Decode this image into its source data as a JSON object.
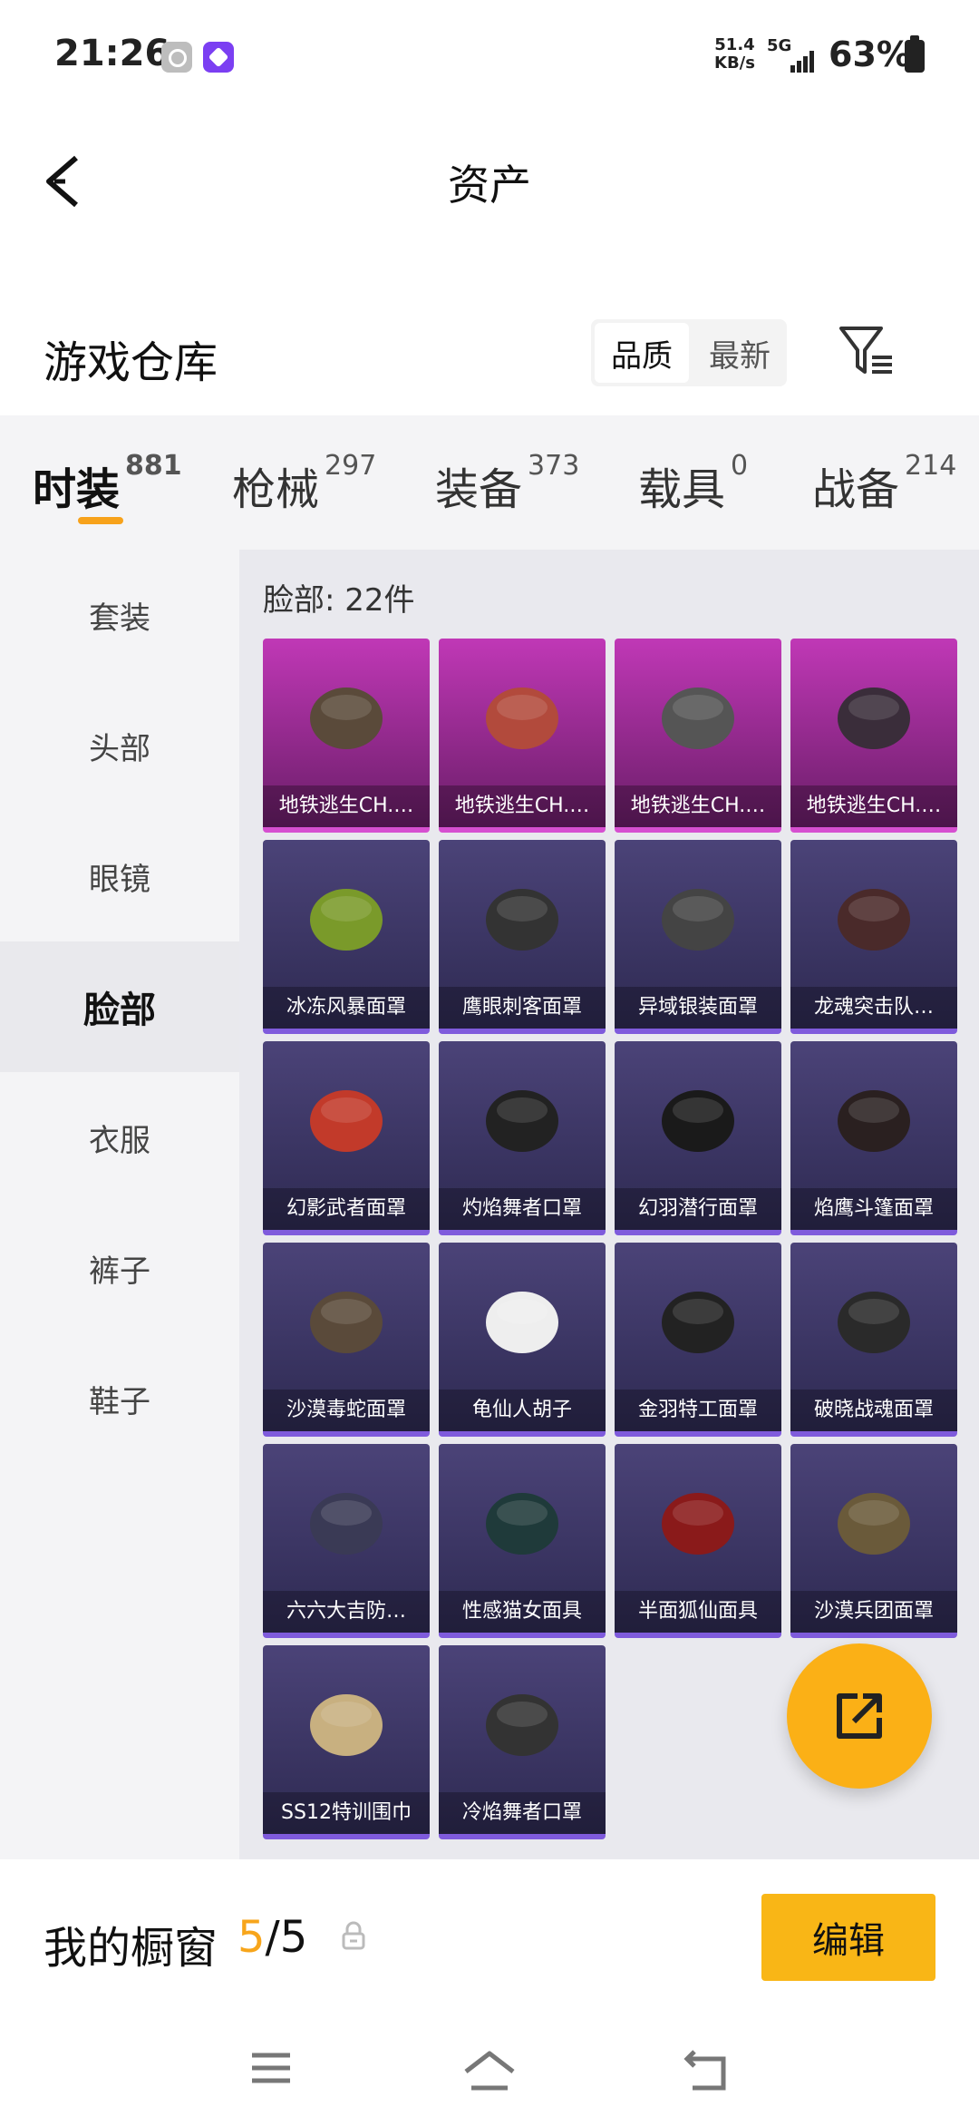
{
  "status_bar": {
    "time": "21:26",
    "speed_value": "51.4",
    "speed_unit": "KB/s",
    "network": "5G",
    "battery": "63%"
  },
  "header": {
    "title": "资产",
    "back_icon": "chevron-left-icon"
  },
  "warehouse": {
    "title": "游戏仓库",
    "sort_options": [
      "品质",
      "最新"
    ],
    "sort_selected": "品质",
    "filter_icon": "filter-icon"
  },
  "category_tabs": [
    {
      "label": "时装",
      "count": "881",
      "active": true
    },
    {
      "label": "枪械",
      "count": "297"
    },
    {
      "label": "装备",
      "count": "373"
    },
    {
      "label": "载具",
      "count": "0"
    },
    {
      "label": "战备",
      "count": "214"
    }
  ],
  "sidebar": {
    "items": [
      "套装",
      "头部",
      "眼镜",
      "脸部",
      "衣服",
      "裤子",
      "鞋子"
    ],
    "active": "脸部"
  },
  "content": {
    "label": "脸部: 22件",
    "items": [
      {
        "name": "地铁逃生CH.…",
        "rarity": "epic"
      },
      {
        "name": "地铁逃生CH.…",
        "rarity": "epic"
      },
      {
        "name": "地铁逃生CH.…",
        "rarity": "epic"
      },
      {
        "name": "地铁逃生CH.…",
        "rarity": "epic"
      },
      {
        "name": "冰冻风暴面罩",
        "rarity": "rare"
      },
      {
        "name": "鹰眼刺客面罩",
        "rarity": "rare"
      },
      {
        "name": "异域银装面罩",
        "rarity": "rare"
      },
      {
        "name": "龙魂突击队…",
        "rarity": "rare"
      },
      {
        "name": "幻影武者面罩",
        "rarity": "rare"
      },
      {
        "name": "灼焰舞者口罩",
        "rarity": "rare"
      },
      {
        "name": "幻羽潜行面罩",
        "rarity": "rare"
      },
      {
        "name": "焰鹰斗篷面罩",
        "rarity": "rare"
      },
      {
        "name": "沙漠毒蛇面罩",
        "rarity": "rare"
      },
      {
        "name": "龟仙人胡子",
        "rarity": "rare"
      },
      {
        "name": "金羽特工面罩",
        "rarity": "rare"
      },
      {
        "name": "破晓战魂面罩",
        "rarity": "rare"
      },
      {
        "name": "六六大吉防…",
        "rarity": "rare"
      },
      {
        "name": "性感猫女面具",
        "rarity": "rare"
      },
      {
        "name": "半面狐仙面具",
        "rarity": "rare"
      },
      {
        "name": "沙漠兵团面罩",
        "rarity": "rare"
      },
      {
        "name": "SS12特训围巾",
        "rarity": "rare"
      },
      {
        "name": "冷焰舞者口罩",
        "rarity": "rare"
      }
    ]
  },
  "fab": {
    "icon": "share-icon"
  },
  "bottom_bar": {
    "title": "我的橱窗",
    "used": "5",
    "total": "/5",
    "lock_icon": "lock-icon",
    "edit_label": "编辑"
  },
  "colors": {
    "accent": "#f9b616",
    "epic": "#c038b6",
    "rare": "#4b4378"
  }
}
